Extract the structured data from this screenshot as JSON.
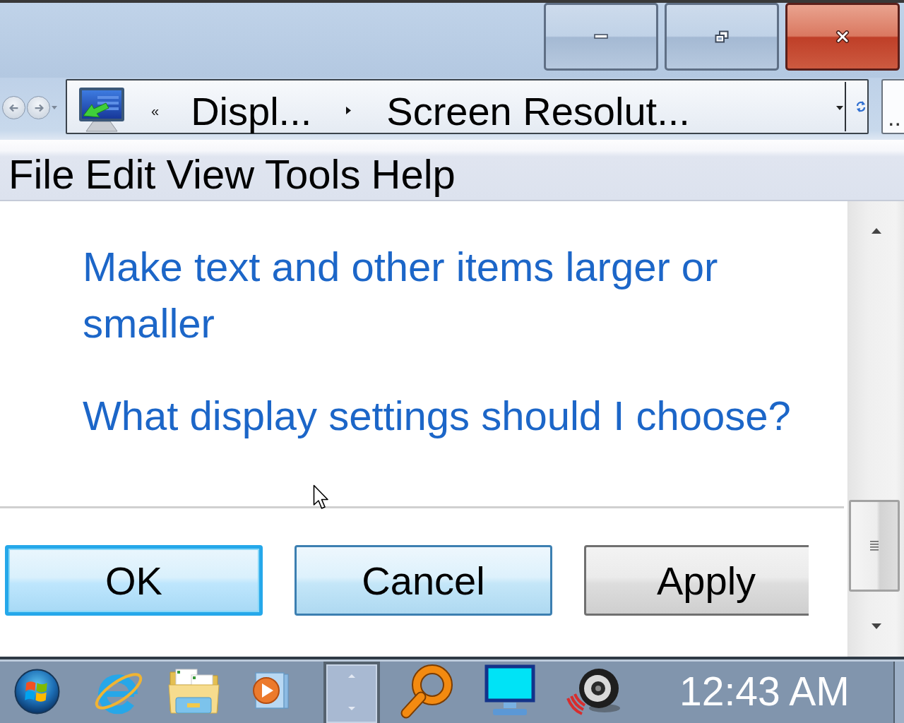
{
  "address_bar": {
    "overflow": "«",
    "breadcrumbs": [
      "Displ...",
      "Screen Resolut..."
    ]
  },
  "search": {
    "placeholder": ".."
  },
  "menu": [
    "File",
    "Edit",
    "View",
    "Tools",
    "Help"
  ],
  "links": [
    "Make text and other items larger or smaller",
    "What display settings should I choose?"
  ],
  "buttons": [
    {
      "label": "OK",
      "kind": "default"
    },
    {
      "label": "Cancel",
      "kind": "hot"
    },
    {
      "label": "Apply",
      "kind": "normal"
    }
  ],
  "taskbar": {
    "clock": "12:43 AM"
  }
}
